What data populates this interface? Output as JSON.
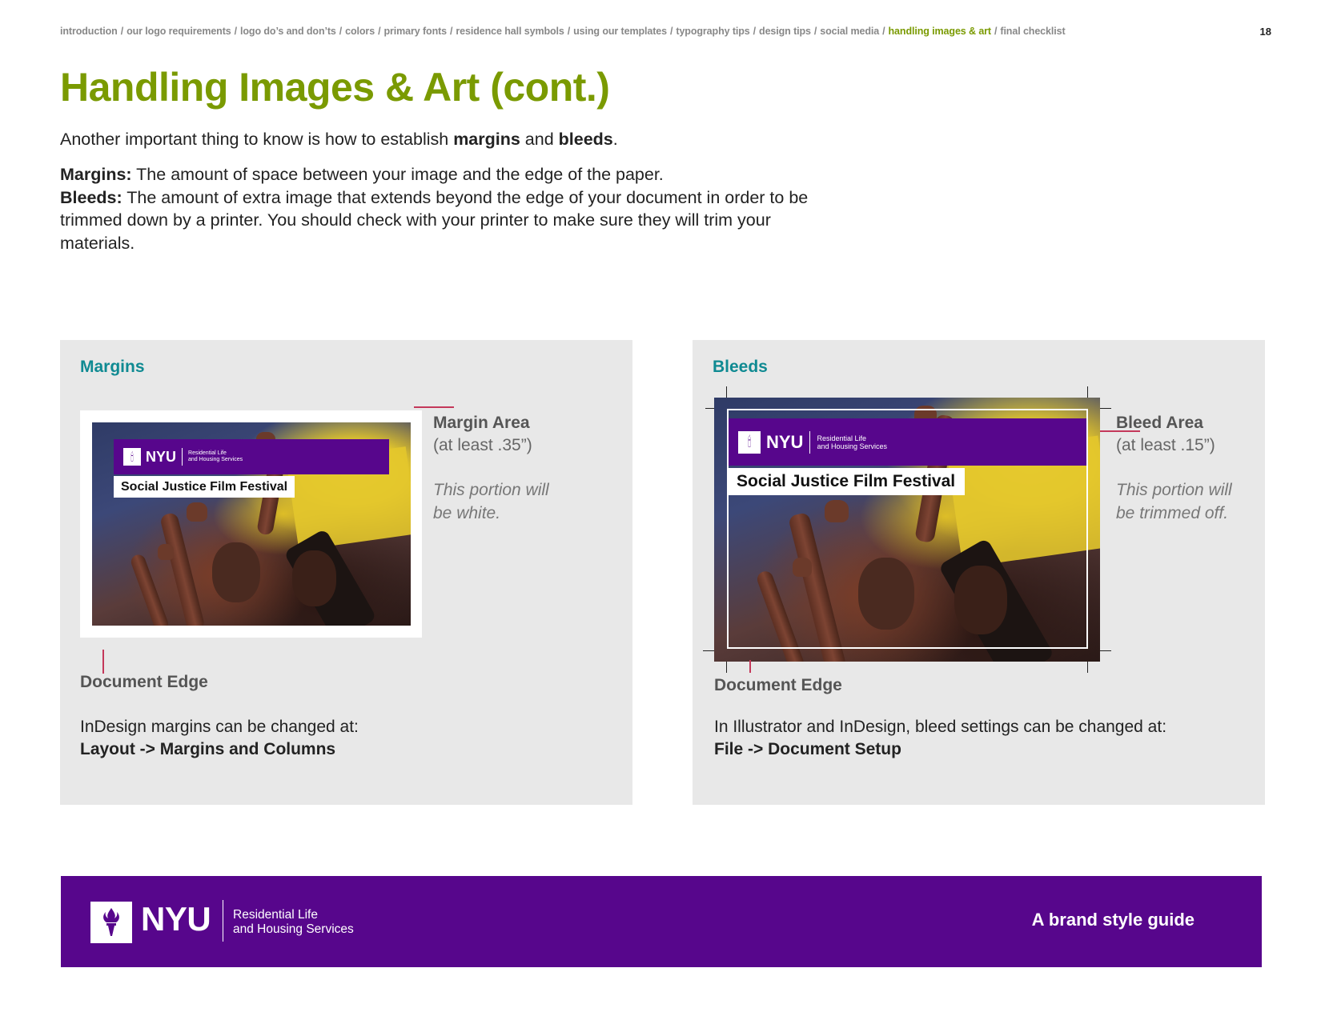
{
  "breadcrumb": {
    "items": [
      {
        "label": "introduction",
        "active": false
      },
      {
        "label": "our logo requirements",
        "active": false
      },
      {
        "label": "logo do’s and don’ts",
        "active": false
      },
      {
        "label": "colors",
        "active": false
      },
      {
        "label": "primary fonts",
        "active": false
      },
      {
        "label": "residence hall symbols",
        "active": false
      },
      {
        "label": "using our templates",
        "active": false
      },
      {
        "label": "typography tips",
        "active": false
      },
      {
        "label": "design tips",
        "active": false
      },
      {
        "label": "social media",
        "active": false
      },
      {
        "label": "handling images & art",
        "active": true
      },
      {
        "label": "final checklist",
        "active": false
      }
    ],
    "separator": "/"
  },
  "page_number": "18",
  "title": "Handling Images & Art (cont.)",
  "intro": {
    "before": "Another important thing to know is how to establish ",
    "term1": "margins",
    "middle": " and ",
    "term2": "bleeds",
    "after": "."
  },
  "definitions": {
    "margins_term": "Margins:",
    "margins_text": " The amount of space between your image and the edge of the paper.",
    "bleeds_term": "Bleeds:",
    "bleeds_text": " The amount of extra image that extends beyond the edge of your document in order to be trimmed down by a printer. You should check with your printer to make sure they will trim your materials."
  },
  "flyer": {
    "nyu": "NYU",
    "dept_line1": "Residential Life",
    "dept_line2": "and Housing Services",
    "title": "Social Justice Film Festival"
  },
  "margins_panel": {
    "title": "Margins",
    "area_label": "Margin Area",
    "area_sub": "(at least .35”)",
    "note_line1": "This portion will",
    "note_line2": "be white.",
    "doc_edge": "Document Edge",
    "howto_text": "InDesign margins can be changed at:",
    "howto_path": "Layout -> Margins and Columns"
  },
  "bleeds_panel": {
    "title": "Bleeds",
    "area_label": "Bleed Area",
    "area_sub": "(at least .15”)",
    "note_line1": "This portion will",
    "note_line2": "be trimmed off.",
    "doc_edge": "Document Edge",
    "howto_text": "In Illustrator and InDesign, bleed settings can be changed at:",
    "howto_path": "File -> Document Setup"
  },
  "footer": {
    "nyu": "NYU",
    "dept": "Residential Life\nand Housing Services",
    "tagline": "A brand style guide"
  },
  "colors": {
    "accent_green": "#7a9a01",
    "nyu_purple": "#57068c",
    "teal": "#0f8a92",
    "panel_bg": "#e8e8e8",
    "pin_red": "#c4385a"
  },
  "icons": [
    "torch-icon"
  ]
}
